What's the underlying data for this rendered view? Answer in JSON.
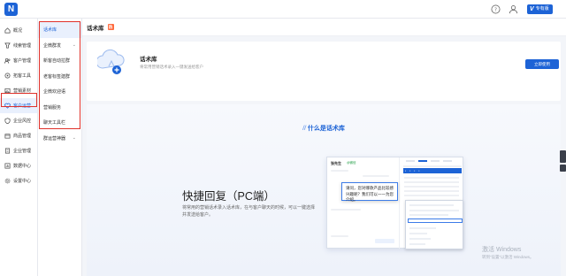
{
  "topbar": {
    "logo_letter": "N",
    "vip_label": "专有版"
  },
  "sidebar": {
    "items": [
      {
        "label": "概况",
        "icon": "home-icon"
      },
      {
        "label": "线索管理",
        "icon": "funnel-icon"
      },
      {
        "label": "客户管理",
        "icon": "users-icon"
      },
      {
        "label": "拓客工具",
        "icon": "target-icon"
      },
      {
        "label": "营销素材",
        "icon": "image-icon"
      },
      {
        "label": "客户运营",
        "icon": "heart-icon"
      },
      {
        "label": "企业风控",
        "icon": "shield-icon"
      },
      {
        "label": "商品管理",
        "icon": "box-icon"
      },
      {
        "label": "企业管理",
        "icon": "building-icon"
      },
      {
        "label": "数据中心",
        "icon": "chart-icon"
      },
      {
        "label": "设置中心",
        "icon": "gear-icon"
      }
    ]
  },
  "submenu": {
    "items": [
      {
        "label": "话术库",
        "expand": false
      },
      {
        "label": "企微群发",
        "expand": true
      },
      {
        "label": "新客自动拉群",
        "expand": false
      },
      {
        "label": "老客标签建群",
        "expand": false
      },
      {
        "label": "企微欢迎语",
        "expand": false
      },
      {
        "label": "营销服务",
        "expand": false
      },
      {
        "label": "聊天工具栏",
        "expand": false
      },
      {
        "label": "群运营神器",
        "expand": true
      }
    ]
  },
  "page": {
    "title": "话术库",
    "hot_badge": "热"
  },
  "intro": {
    "title": "话术库",
    "desc": "将常用营销话术录入一键发送给客户",
    "button": "立即使用"
  },
  "feature": {
    "heading": "什么是话术库",
    "title": "快捷回复（PC端）",
    "desc": "将常用的营销话术录入话术库，在与客户聊天的时候，可以一键选择并发送给客户。",
    "mock": {
      "contact_name": "张先生",
      "contact_tag": "@微信",
      "popup_text": "请问，您对哪款产品比较感兴趣呢？我们可以一一为您介绍。"
    }
  },
  "watermark": {
    "line1": "激活 Windows",
    "line2": "转到“设置”以激活 Windows。"
  },
  "colors": {
    "accent": "#1d63d6",
    "highlight_box": "#e0322b"
  }
}
